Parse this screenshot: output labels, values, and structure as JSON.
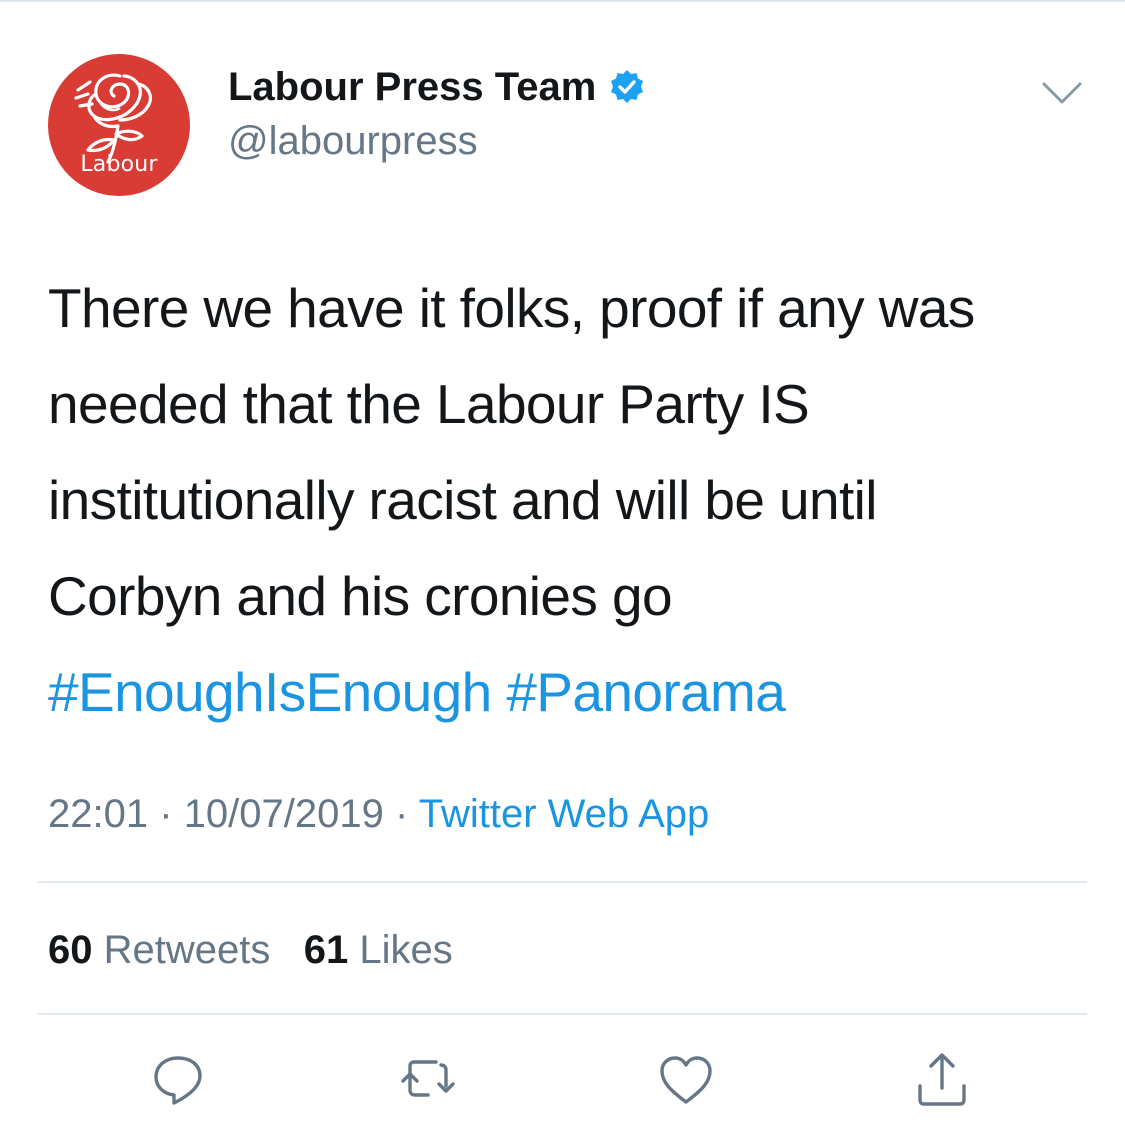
{
  "tweet": {
    "avatar_label": "Labour",
    "display_name": "Labour Press Team",
    "handle": "@labourpress",
    "verified": true,
    "text_lines": [
      "There we have it folks, proof if any was",
      "needed that the Labour Party IS",
      "institutionally racist and will be until",
      "Corbyn and his cronies go"
    ],
    "hashtags": [
      "#EnoughIsEnough",
      "#Panorama"
    ],
    "time": "22:01",
    "date": "10/07/2019",
    "separator": "·",
    "source": "Twitter Web App",
    "retweets": {
      "count": "60",
      "label": "Retweets"
    },
    "likes": {
      "count": "61",
      "label": "Likes"
    }
  },
  "icons": {
    "more": "chevron-down-icon",
    "reply": "reply-icon",
    "retweet": "retweet-icon",
    "like": "heart-icon",
    "share": "share-icon"
  },
  "colors": {
    "avatar_bg": "#d93b35",
    "link": "#1b95e0",
    "verified": "#1da1f2",
    "secondary_text": "#657786",
    "primary_text": "#14171a",
    "divider": "#e1e8ed"
  }
}
